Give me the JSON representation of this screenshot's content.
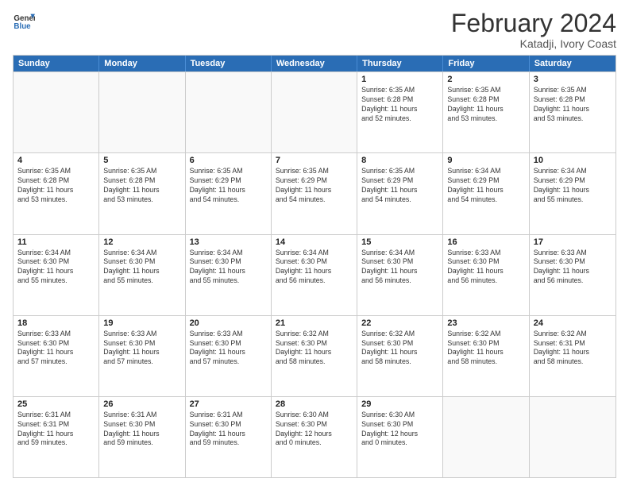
{
  "header": {
    "title": "February 2024",
    "subtitle": "Katadji, Ivory Coast"
  },
  "days": [
    "Sunday",
    "Monday",
    "Tuesday",
    "Wednesday",
    "Thursday",
    "Friday",
    "Saturday"
  ],
  "weeks": [
    [
      {
        "day": "",
        "text": ""
      },
      {
        "day": "",
        "text": ""
      },
      {
        "day": "",
        "text": ""
      },
      {
        "day": "",
        "text": ""
      },
      {
        "day": "1",
        "text": "Sunrise: 6:35 AM\nSunset: 6:28 PM\nDaylight: 11 hours\nand 52 minutes."
      },
      {
        "day": "2",
        "text": "Sunrise: 6:35 AM\nSunset: 6:28 PM\nDaylight: 11 hours\nand 53 minutes."
      },
      {
        "day": "3",
        "text": "Sunrise: 6:35 AM\nSunset: 6:28 PM\nDaylight: 11 hours\nand 53 minutes."
      }
    ],
    [
      {
        "day": "4",
        "text": "Sunrise: 6:35 AM\nSunset: 6:28 PM\nDaylight: 11 hours\nand 53 minutes."
      },
      {
        "day": "5",
        "text": "Sunrise: 6:35 AM\nSunset: 6:28 PM\nDaylight: 11 hours\nand 53 minutes."
      },
      {
        "day": "6",
        "text": "Sunrise: 6:35 AM\nSunset: 6:29 PM\nDaylight: 11 hours\nand 54 minutes."
      },
      {
        "day": "7",
        "text": "Sunrise: 6:35 AM\nSunset: 6:29 PM\nDaylight: 11 hours\nand 54 minutes."
      },
      {
        "day": "8",
        "text": "Sunrise: 6:35 AM\nSunset: 6:29 PM\nDaylight: 11 hours\nand 54 minutes."
      },
      {
        "day": "9",
        "text": "Sunrise: 6:34 AM\nSunset: 6:29 PM\nDaylight: 11 hours\nand 54 minutes."
      },
      {
        "day": "10",
        "text": "Sunrise: 6:34 AM\nSunset: 6:29 PM\nDaylight: 11 hours\nand 55 minutes."
      }
    ],
    [
      {
        "day": "11",
        "text": "Sunrise: 6:34 AM\nSunset: 6:30 PM\nDaylight: 11 hours\nand 55 minutes."
      },
      {
        "day": "12",
        "text": "Sunrise: 6:34 AM\nSunset: 6:30 PM\nDaylight: 11 hours\nand 55 minutes."
      },
      {
        "day": "13",
        "text": "Sunrise: 6:34 AM\nSunset: 6:30 PM\nDaylight: 11 hours\nand 55 minutes."
      },
      {
        "day": "14",
        "text": "Sunrise: 6:34 AM\nSunset: 6:30 PM\nDaylight: 11 hours\nand 56 minutes."
      },
      {
        "day": "15",
        "text": "Sunrise: 6:34 AM\nSunset: 6:30 PM\nDaylight: 11 hours\nand 56 minutes."
      },
      {
        "day": "16",
        "text": "Sunrise: 6:33 AM\nSunset: 6:30 PM\nDaylight: 11 hours\nand 56 minutes."
      },
      {
        "day": "17",
        "text": "Sunrise: 6:33 AM\nSunset: 6:30 PM\nDaylight: 11 hours\nand 56 minutes."
      }
    ],
    [
      {
        "day": "18",
        "text": "Sunrise: 6:33 AM\nSunset: 6:30 PM\nDaylight: 11 hours\nand 57 minutes."
      },
      {
        "day": "19",
        "text": "Sunrise: 6:33 AM\nSunset: 6:30 PM\nDaylight: 11 hours\nand 57 minutes."
      },
      {
        "day": "20",
        "text": "Sunrise: 6:33 AM\nSunset: 6:30 PM\nDaylight: 11 hours\nand 57 minutes."
      },
      {
        "day": "21",
        "text": "Sunrise: 6:32 AM\nSunset: 6:30 PM\nDaylight: 11 hours\nand 58 minutes."
      },
      {
        "day": "22",
        "text": "Sunrise: 6:32 AM\nSunset: 6:30 PM\nDaylight: 11 hours\nand 58 minutes."
      },
      {
        "day": "23",
        "text": "Sunrise: 6:32 AM\nSunset: 6:30 PM\nDaylight: 11 hours\nand 58 minutes."
      },
      {
        "day": "24",
        "text": "Sunrise: 6:32 AM\nSunset: 6:31 PM\nDaylight: 11 hours\nand 58 minutes."
      }
    ],
    [
      {
        "day": "25",
        "text": "Sunrise: 6:31 AM\nSunset: 6:31 PM\nDaylight: 11 hours\nand 59 minutes."
      },
      {
        "day": "26",
        "text": "Sunrise: 6:31 AM\nSunset: 6:30 PM\nDaylight: 11 hours\nand 59 minutes."
      },
      {
        "day": "27",
        "text": "Sunrise: 6:31 AM\nSunset: 6:30 PM\nDaylight: 11 hours\nand 59 minutes."
      },
      {
        "day": "28",
        "text": "Sunrise: 6:30 AM\nSunset: 6:30 PM\nDaylight: 12 hours\nand 0 minutes."
      },
      {
        "day": "29",
        "text": "Sunrise: 6:30 AM\nSunset: 6:30 PM\nDaylight: 12 hours\nand 0 minutes."
      },
      {
        "day": "",
        "text": ""
      },
      {
        "day": "",
        "text": ""
      }
    ]
  ]
}
